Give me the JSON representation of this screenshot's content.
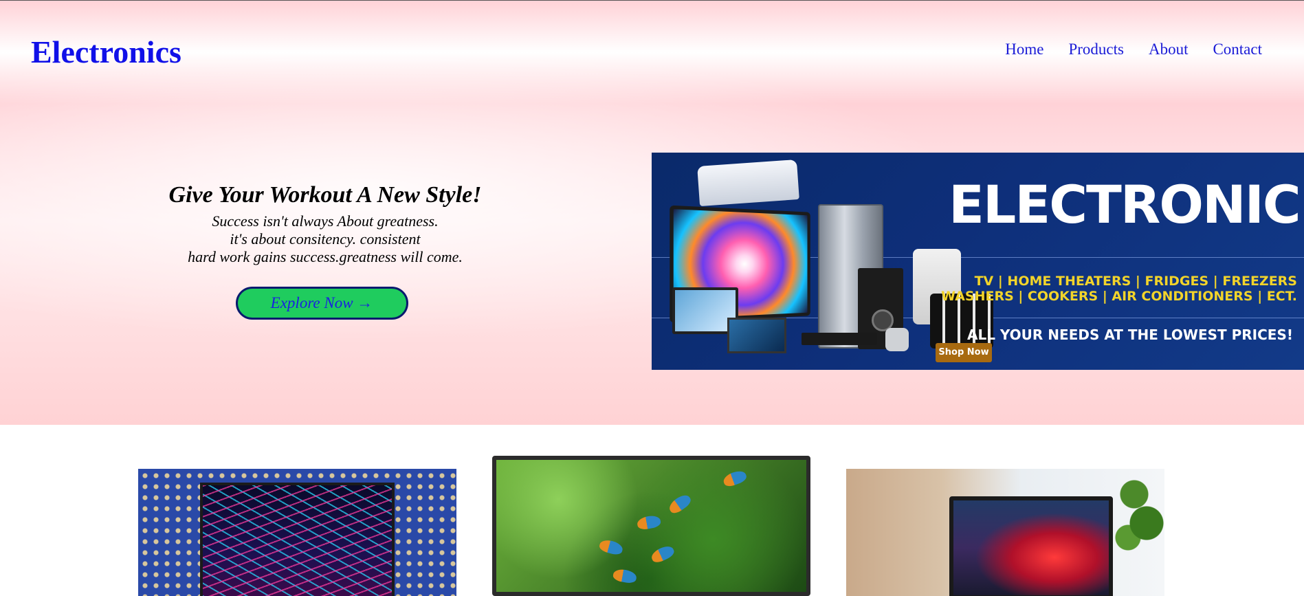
{
  "header": {
    "logo": "Electronics",
    "nav": [
      "Home",
      "Products",
      "About",
      "Contact"
    ]
  },
  "hero": {
    "title": "Give Your Workout A New Style!",
    "lines": [
      "Success isn't always About greatness.",
      "it's about consitency. consistent",
      "hard work gains success.greatness will come."
    ],
    "cta": "Explore Now →"
  },
  "banner": {
    "title": "ELECTRONICS",
    "categories_line1": "TV | HOME THEATERS | FRIDGES | FREEZERS",
    "categories_line2": "WASHERS | COOKERS | AIR CONDITIONERS | ECT.",
    "tagline": "ALL YOUR NEEDS AT THE LOWEST PRICES!",
    "shop_now": "Shop Now"
  },
  "colors": {
    "brand": "#1010e8",
    "cta_bg": "#1fcc5e",
    "banner_bg": "#0e2f7a",
    "banner_accent": "#f2d42a"
  }
}
